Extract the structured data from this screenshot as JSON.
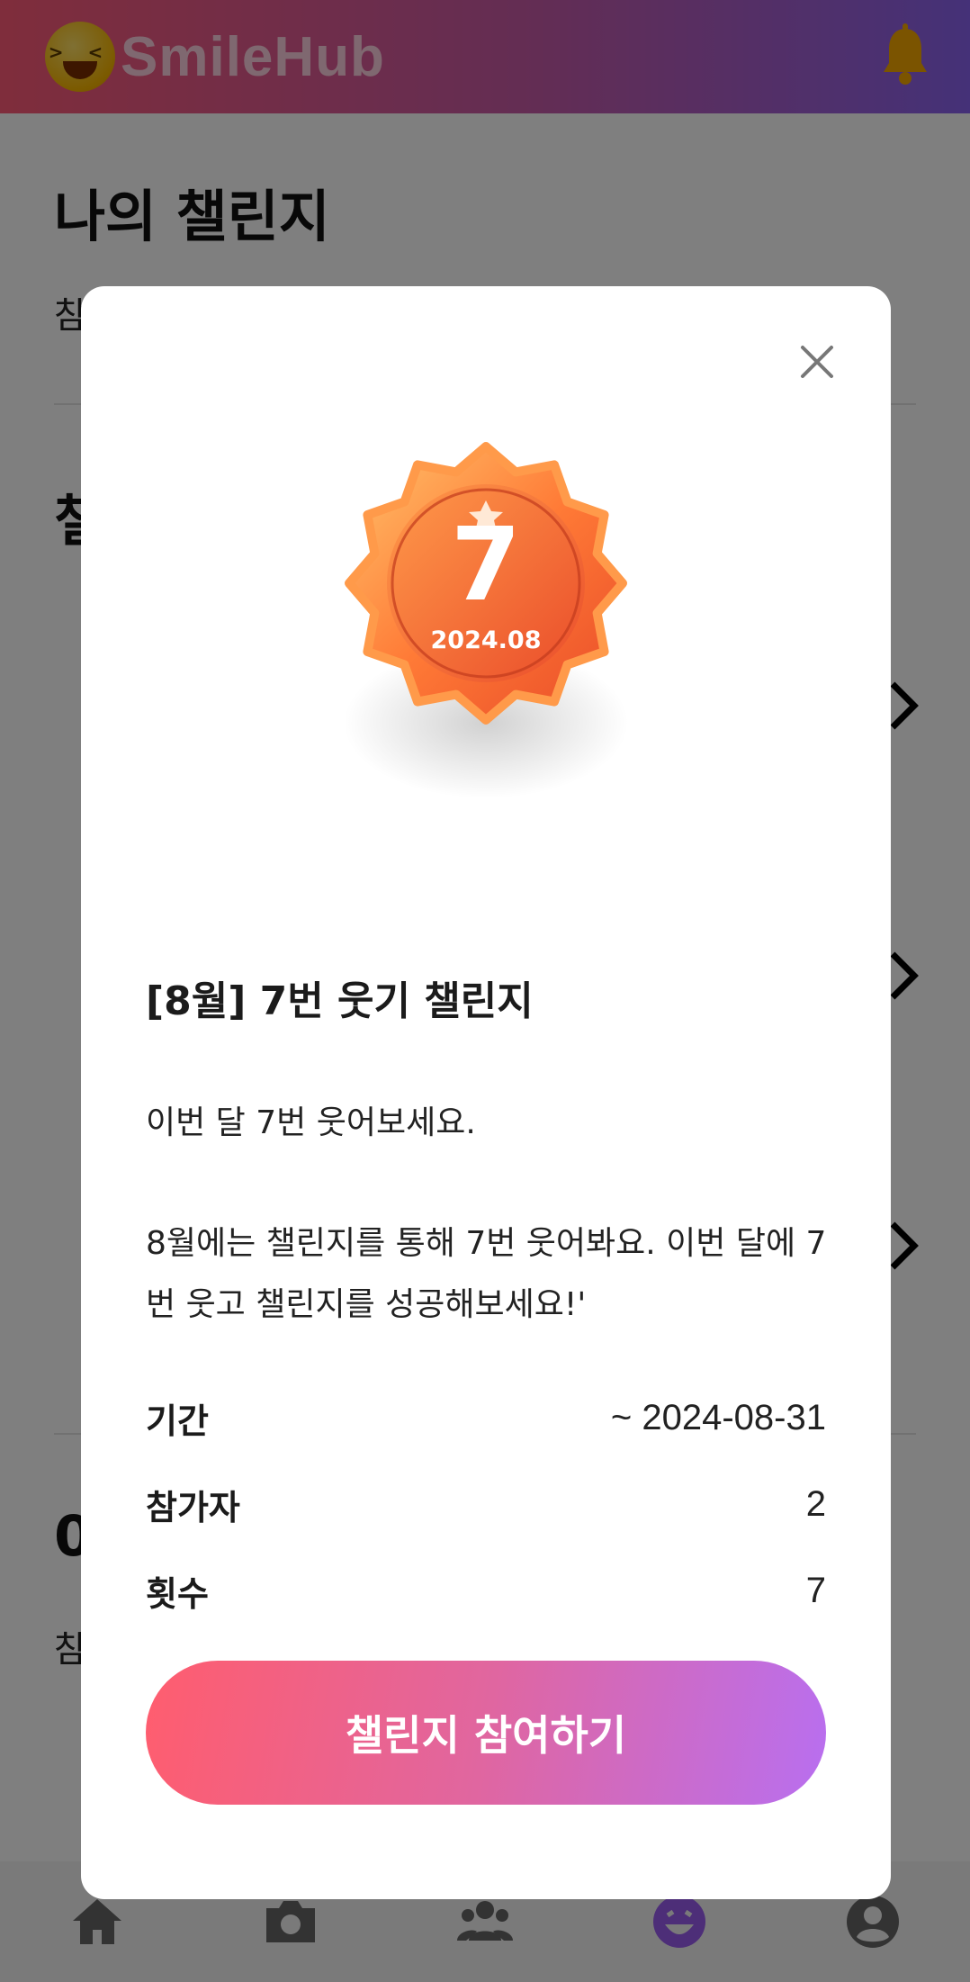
{
  "app": {
    "brand": "SmileHub",
    "logo_icon": "laughing-face-emoji",
    "bell_icon": "bell-icon",
    "brand_gradient": [
      "#ff5a78",
      "#8a63f0"
    ]
  },
  "page": {
    "title": "나의 챌린지",
    "subtitle_partial": "참",
    "section_partial": "챌",
    "section2_partial": "0",
    "subtitle2_partial": "참"
  },
  "modal": {
    "close_icon": "close-icon",
    "badge": {
      "number": "7",
      "date": "2024.08",
      "colors": [
        "#ff8a3d",
        "#f0502c"
      ]
    },
    "title": "[8월] 7번 웃기 챌린지",
    "description_short": "이번 달 7번 웃어보세요.",
    "description_long": "8월에는 챌린지를 통해 7번 웃어봐요. 이번 달에 7번 웃고 챌린지를 성공해보세요!'",
    "info": [
      {
        "label": "기간",
        "value": "~ 2024-08-31"
      },
      {
        "label": "참가자",
        "value": "2"
      },
      {
        "label": "횟수",
        "value": "7"
      }
    ],
    "join_button": "챌린지 참여하기",
    "button_gradient": [
      "#ff5d6e",
      "#b86ff0"
    ]
  },
  "bottom_nav": [
    {
      "icon": "home-icon"
    },
    {
      "icon": "camera-icon"
    },
    {
      "icon": "group-icon"
    },
    {
      "icon": "smile-icon",
      "active": true
    },
    {
      "icon": "profile-icon"
    }
  ]
}
